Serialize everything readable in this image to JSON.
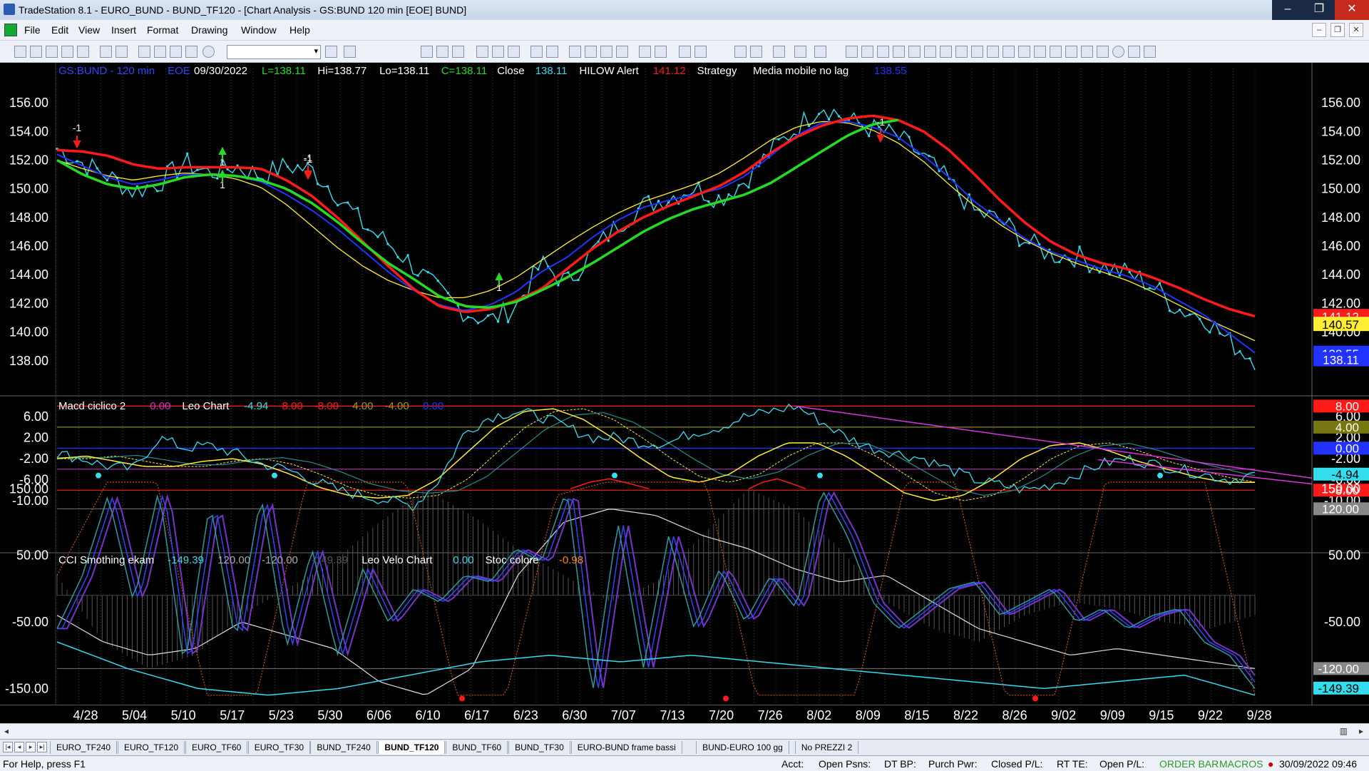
{
  "window": {
    "title": "TradeStation 8.1 - EURO_BUND - BUND_TF120 - [Chart Analysis - GS:BUND  120 min  [EOE] BUND]",
    "minimize": "–",
    "maximize": "❐",
    "close": "✕"
  },
  "menu": [
    "File",
    "Edit",
    "View",
    "Insert",
    "Format",
    "Drawing",
    "Window",
    "Help"
  ],
  "mdi_buttons": [
    "–",
    "❐",
    "✕"
  ],
  "colors": {
    "red": "#ff1a1a",
    "green": "#22dd22",
    "blue": "#2233ff",
    "cyan": "#33ddee",
    "yellow": "#ffee33",
    "magenta": "#cc33cc"
  },
  "price_header": [
    {
      "text": "GS:BUND - 120 min",
      "color": "#3344ff"
    },
    {
      "text": "EOE",
      "color": "#3344ff"
    },
    {
      "text": "09/30/2022",
      "color": "#ffffff"
    },
    {
      "text": "L=138.11",
      "color": "#22dd22"
    },
    {
      "text": "Hi=138.77",
      "color": "#ffffff"
    },
    {
      "text": "Lo=138.11",
      "color": "#ffffff"
    },
    {
      "text": "C=138.11",
      "color": "#22dd22"
    },
    {
      "text": "Close",
      "color": "#ffffff"
    },
    {
      "text": "138.11",
      "color": "#33ddee"
    },
    {
      "text": "HILOW Alert",
      "color": "#ffffff"
    },
    {
      "text": "141.12",
      "color": "#ff1a1a"
    },
    {
      "text": "Strategy",
      "color": "#ffffff"
    },
    {
      "text": "Media mobile no lag",
      "color": "#ffffff"
    },
    {
      "text": "138.55",
      "color": "#2233ff"
    }
  ],
  "macd_header": [
    {
      "text": "Macd ciclico 2",
      "color": "#ffffff"
    },
    {
      "text": "0.00",
      "color": "#cc33cc"
    },
    {
      "text": "Leo Chart",
      "color": "#ffffff"
    },
    {
      "text": "-4.94",
      "color": "#33ddee"
    },
    {
      "text": "8.00",
      "color": "#ff1a1a"
    },
    {
      "text": "-8.00",
      "color": "#ff1a1a"
    },
    {
      "text": "4.00",
      "color": "#999922"
    },
    {
      "text": "-4.00",
      "color": "#999922"
    },
    {
      "text": "0.00",
      "color": "#2233ff"
    }
  ],
  "cci_header": [
    {
      "text": "CCI Smothing ekam",
      "color": "#ffffff"
    },
    {
      "text": "-149.39",
      "color": "#33ddee"
    },
    {
      "text": "120.00",
      "color": "#aaaaaa"
    },
    {
      "text": "-120.00",
      "color": "#aaaaaa"
    },
    {
      "text": "-149.39",
      "color": "#555555"
    },
    {
      "text": "Leo Velo Chart",
      "color": "#ffffff"
    },
    {
      "text": "0.00",
      "color": "#33ddee"
    },
    {
      "text": "Stoc colore",
      "color": "#ffffff"
    },
    {
      "text": "-0.98",
      "color": "#ff8800"
    }
  ],
  "price_axis_ticks": [
    "156.00",
    "154.00",
    "152.00",
    "150.00",
    "148.00",
    "146.00",
    "144.00",
    "142.00",
    "140.00",
    "138.00"
  ],
  "price_tags": [
    {
      "text": "141.12",
      "bg": "#ff1a1a",
      "fg": "#ffffff"
    },
    {
      "text": "140.57",
      "bg": "#ffee33",
      "fg": "#000000"
    },
    {
      "text": "138.55",
      "bg": "#2233ff",
      "fg": "#ffffff"
    },
    {
      "text": "138.11",
      "bg": "#2233ff",
      "fg": "#ffffff"
    }
  ],
  "macd_axis_ticks": [
    "6.00",
    "2.00",
    "-2.00",
    "-6.00",
    "-10.00"
  ],
  "macd_tags": [
    {
      "text": "8.00",
      "bg": "#ff1a1a",
      "fg": "#ffffff"
    },
    {
      "text": "4.00",
      "bg": "#777711",
      "fg": "#ffffff"
    },
    {
      "text": "0.00",
      "bg": "#2233ff",
      "fg": "#ffffff"
    },
    {
      "text": "-4.94",
      "bg": "#33ddee",
      "fg": "#000000"
    },
    {
      "text": "-8.00",
      "bg": "#ff1a1a",
      "fg": "#ffffff"
    }
  ],
  "cci_axis_ticks": [
    "150.00",
    "50.00",
    "-50.00",
    "-150.00"
  ],
  "cci_tags": [
    {
      "text": "120.00",
      "bg": "#888888",
      "fg": "#ffffff"
    },
    {
      "text": "-120.00",
      "bg": "#888888",
      "fg": "#ffffff"
    },
    {
      "text": "-149.39",
      "bg": "#33ddee",
      "fg": "#000000"
    }
  ],
  "dates": [
    "4/28",
    "5/04",
    "5/10",
    "5/17",
    "5/23",
    "5/30",
    "6/06",
    "6/10",
    "6/17",
    "6/23",
    "6/30",
    "7/07",
    "7/13",
    "7/20",
    "7/26",
    "8/02",
    "8/09",
    "8/15",
    "8/22",
    "8/26",
    "9/02",
    "9/09",
    "9/15",
    "9/22",
    "9/28"
  ],
  "trade_markers": [
    "-1",
    "1",
    "-1",
    "1",
    "-1",
    "1",
    "-1"
  ],
  "chart_data": {
    "type": "line",
    "price": {
      "ylim": [
        136,
        157
      ],
      "close": [
        152.8,
        151.8,
        150.9,
        149.8,
        150.4,
        151.8,
        151.1,
        151.6,
        150.9,
        151.6,
        151.3,
        149.6,
        147.5,
        146.2,
        144.6,
        142.8,
        141.4,
        140.8,
        141.8,
        144.8,
        143.4,
        145.6,
        147.5,
        148.8,
        149.4,
        150.1,
        149.3,
        150.6,
        152.6,
        154.2,
        155.9,
        154.8,
        154.2,
        153.6,
        152.2,
        150.5,
        148.4,
        147.8,
        146.4,
        145.4,
        145.3,
        144.6,
        144.1,
        143.2,
        141.6,
        141.1,
        139.3,
        138.1
      ],
      "red_ma": [
        152.7,
        152.6,
        152.3,
        151.7,
        151.4,
        151.5,
        151.5,
        151.5,
        151.4,
        150.6,
        149.5,
        148.0,
        146.3,
        144.6,
        143.0,
        141.8,
        141.4,
        141.6,
        142.2,
        143.0,
        144.4,
        145.8,
        147.0,
        148.0,
        148.8,
        149.5,
        150.2,
        151.2,
        152.5,
        153.6,
        154.4,
        154.9,
        155.1,
        154.8,
        154.0,
        152.7,
        151.0,
        149.2,
        147.6,
        146.3,
        145.4,
        144.8,
        144.4,
        143.8,
        143.1,
        142.3,
        141.6,
        141.1
      ],
      "blue_ma": [
        152.4,
        151.6,
        150.8,
        150.3,
        150.6,
        151.0,
        151.0,
        150.9,
        150.5,
        149.6,
        148.5,
        147.2,
        145.7,
        144.2,
        142.9,
        141.9,
        141.5,
        141.9,
        142.8,
        144.2,
        145.2,
        146.6,
        147.8,
        148.7,
        149.2,
        149.6,
        150.0,
        150.9,
        152.3,
        153.7,
        154.6,
        154.7,
        154.3,
        153.6,
        152.3,
        150.8,
        149.1,
        147.8,
        146.5,
        145.6,
        145.0,
        144.4,
        143.9,
        143.2,
        142.2,
        141.2,
        139.9,
        138.55
      ],
      "yellow_ma": [
        152.0,
        151.4,
        150.9,
        150.6,
        150.9,
        151.1,
        151.0,
        150.7,
        150.1,
        148.9,
        147.4,
        145.9,
        144.6,
        143.6,
        142.9,
        142.4,
        142.4,
        142.9,
        143.8,
        145.0,
        146.2,
        147.3,
        148.3,
        149.1,
        149.7,
        150.3,
        151.1,
        152.2,
        153.4,
        154.3,
        154.7,
        154.6,
        154.1,
        153.2,
        151.9,
        150.3,
        148.8,
        147.5,
        146.4,
        145.5,
        144.8,
        144.2,
        143.6,
        142.8,
        141.9,
        141.0,
        140.2,
        139.4
      ],
      "green_ma": [
        152.0,
        151.0,
        150.3,
        150.0,
        150.3,
        150.8,
        151.0,
        150.9,
        150.6,
        150.0,
        149.0,
        147.7,
        146.2,
        144.8,
        143.7,
        142.5,
        141.8,
        141.7,
        142.1,
        142.9,
        143.8,
        144.8,
        145.9,
        147.0,
        147.9,
        148.6,
        149.1,
        149.6,
        150.4,
        151.5,
        152.6,
        153.7,
        154.5,
        154.8
      ]
    },
    "macd": {
      "ylim": [
        -12,
        9
      ],
      "levels": [
        8,
        4,
        0,
        -4,
        -8
      ],
      "leo": [
        -1,
        -2,
        -3.5,
        -4,
        2,
        0,
        0.5,
        -1,
        -3,
        -4,
        -6,
        -8,
        -9,
        -10,
        -11,
        -6,
        3,
        6,
        7,
        6,
        4,
        2,
        2,
        1,
        1,
        3,
        4,
        6,
        7,
        8,
        5,
        2,
        0,
        -1,
        -2,
        -4,
        -6,
        -7,
        -8,
        -7,
        -5,
        -3,
        -2,
        -3,
        -4,
        -5,
        -6,
        -5
      ],
      "yellow": [
        -2,
        -1.5,
        -2.5,
        -3.5,
        -3.5,
        -2.5,
        -2,
        -3,
        -5,
        -7.5,
        -9,
        -9.5,
        -9,
        -6,
        -1,
        4,
        7,
        7.5,
        5.5,
        2,
        -2,
        -5.5,
        -6.5,
        -5,
        -1.5,
        1,
        1,
        -1.5,
        -5,
        -8.5,
        -10,
        -9,
        -6,
        -2,
        0.5,
        1,
        -0.5,
        -2.5,
        -4,
        -5.5,
        -6.5,
        -6.5
      ]
    },
    "cci": {
      "ylim": [
        -170,
        190
      ],
      "levels": [
        120,
        -120
      ],
      "cci": [
        -60,
        20,
        140,
        -20,
        150,
        -120,
        130,
        -80,
        140,
        -90,
        60,
        -100,
        30,
        -50,
        0,
        -20,
        20,
        10,
        60,
        40,
        150,
        -160,
        100,
        -120,
        80,
        -60,
        30,
        -50,
        20,
        -30,
        150,
        80,
        -20,
        -60,
        -30,
        0,
        10,
        -40,
        -20,
        0,
        -50,
        -30,
        -60,
        -40,
        -30,
        -80,
        -100,
        -150
      ]
    }
  },
  "tabs": [
    "EURO_TF240",
    "EURO_TF120",
    "EURO_TF60",
    "EURO_TF30",
    "BUND_TF240",
    "BUND_TF120",
    "BUND_TF60",
    "BUND_TF30",
    "EURO-BUND frame bassi",
    "BUND-EURO 100 gg",
    "No PREZZI 2"
  ],
  "active_tab": "BUND_TF120",
  "status": {
    "help": "For Help, press F1",
    "acct": "Acct:",
    "open_psns": "Open Psns:",
    "dt_bp": "DT BP:",
    "purch_pwr": "Purch Pwr:",
    "closed_pl": "Closed P/L:",
    "rt_te": "RT TE:",
    "open_pl": "Open P/L:",
    "order_bar": "ORDER BAR",
    "macros": "MACROS",
    "datetime": "30/09/2022 09:46"
  }
}
